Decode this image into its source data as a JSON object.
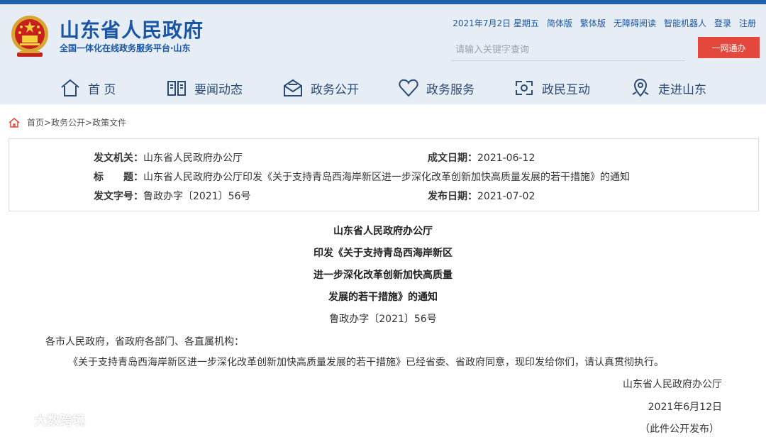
{
  "header": {
    "site_title": "山东省人民政府",
    "site_subtitle": "全国一体化在线政务服务平台·山东",
    "top_links": [
      "2021年7月2日 星期五",
      "简体版",
      "繁体版",
      "无障碍阅读",
      "智能机器人",
      "登录",
      "注册"
    ],
    "search_placeholder": "请输入关键字查询",
    "search_button": "一网通办",
    "accent_color": "#1a56a6",
    "button_color": "#e4473c"
  },
  "nav": [
    {
      "label": "首 页",
      "icon": "home-icon"
    },
    {
      "label": "要闻动态",
      "icon": "book-icon"
    },
    {
      "label": "政务公开",
      "icon": "envelope-icon"
    },
    {
      "label": "政务服务",
      "icon": "heart-icon"
    },
    {
      "label": "政民互动",
      "icon": "link-icon"
    },
    {
      "label": "走进山东",
      "icon": "map-pin-icon"
    }
  ],
  "breadcrumb": "首页>政务公开>政策文件",
  "meta": {
    "issuer_label": "发文机关：",
    "issuer": "山东省人民政府办公厅",
    "date_label": "成文日期：",
    "date": "2021-06-12",
    "title_label": "标　　题：",
    "title": "山东省人民政府办公厅印发《关于支持青岛西海岸新区进一步深化改革创新加快高质量发展的若干措施》的通知",
    "docno_label": "发文字号：",
    "docno": "鲁政办字〔2021〕56号",
    "pub_label": "发布日期：",
    "pub": "2021-07-02"
  },
  "document": {
    "title_lines": [
      "山东省人民政府办公厅",
      "印发《关于支持青岛西海岸新区",
      "进一步深化改革创新加快高质量",
      "发展的若干措施》的通知"
    ],
    "doc_number": "鲁政办字〔2021〕56号",
    "recipients": "各市人民政府，省政府各部门、各直属机构：",
    "body": "《关于支持青岛西海岸新区进一步深化改革创新加快高质量发展的若干措施》已经省委、省政府同意，现印发给你们，请认真贯彻执行。",
    "signature": "山东省人民政府办公厅",
    "sign_date": "2021年6月12日",
    "note": "（此件公开发布）"
  },
  "watermark": "大数跨境"
}
